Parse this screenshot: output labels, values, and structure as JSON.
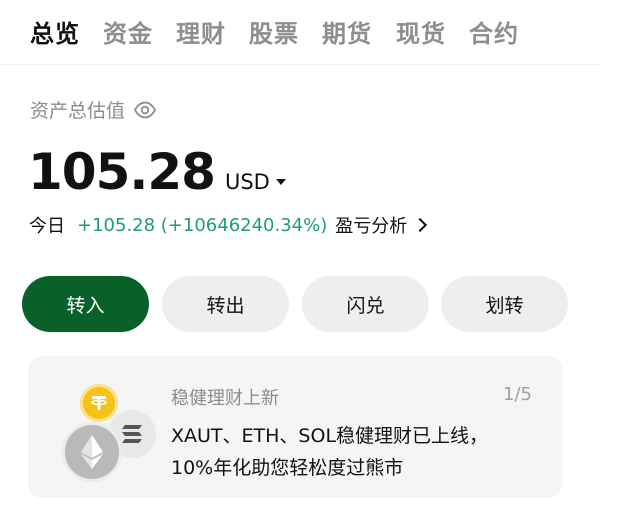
{
  "tabs": [
    {
      "label": "总览",
      "active": true
    },
    {
      "label": "资金",
      "active": false
    },
    {
      "label": "理财",
      "active": false
    },
    {
      "label": "股票",
      "active": false
    },
    {
      "label": "期货",
      "active": false
    },
    {
      "label": "现货",
      "active": false
    },
    {
      "label": "合约",
      "active": false
    }
  ],
  "asset": {
    "label": "资产总估值",
    "value": "105.28",
    "currency": "USD"
  },
  "today": {
    "label": "今日",
    "gain": "+105.28 (+10646240.34%)",
    "pnl_link": "盈亏分析"
  },
  "actions": [
    "转入",
    "转出",
    "闪兑",
    "划转"
  ],
  "banner": {
    "title": "稳健理财上新",
    "page": "1/5",
    "line1": "XAUT、ETH、SOL稳健理财已上线，",
    "line2": "10%年化助您轻松度过熊市",
    "coins": [
      "tether-gold-icon",
      "solana-icon",
      "ethereum-icon"
    ]
  },
  "colors": {
    "primary": "#09612a",
    "gain": "#1ea06a",
    "muted": "#8c8c8c"
  }
}
